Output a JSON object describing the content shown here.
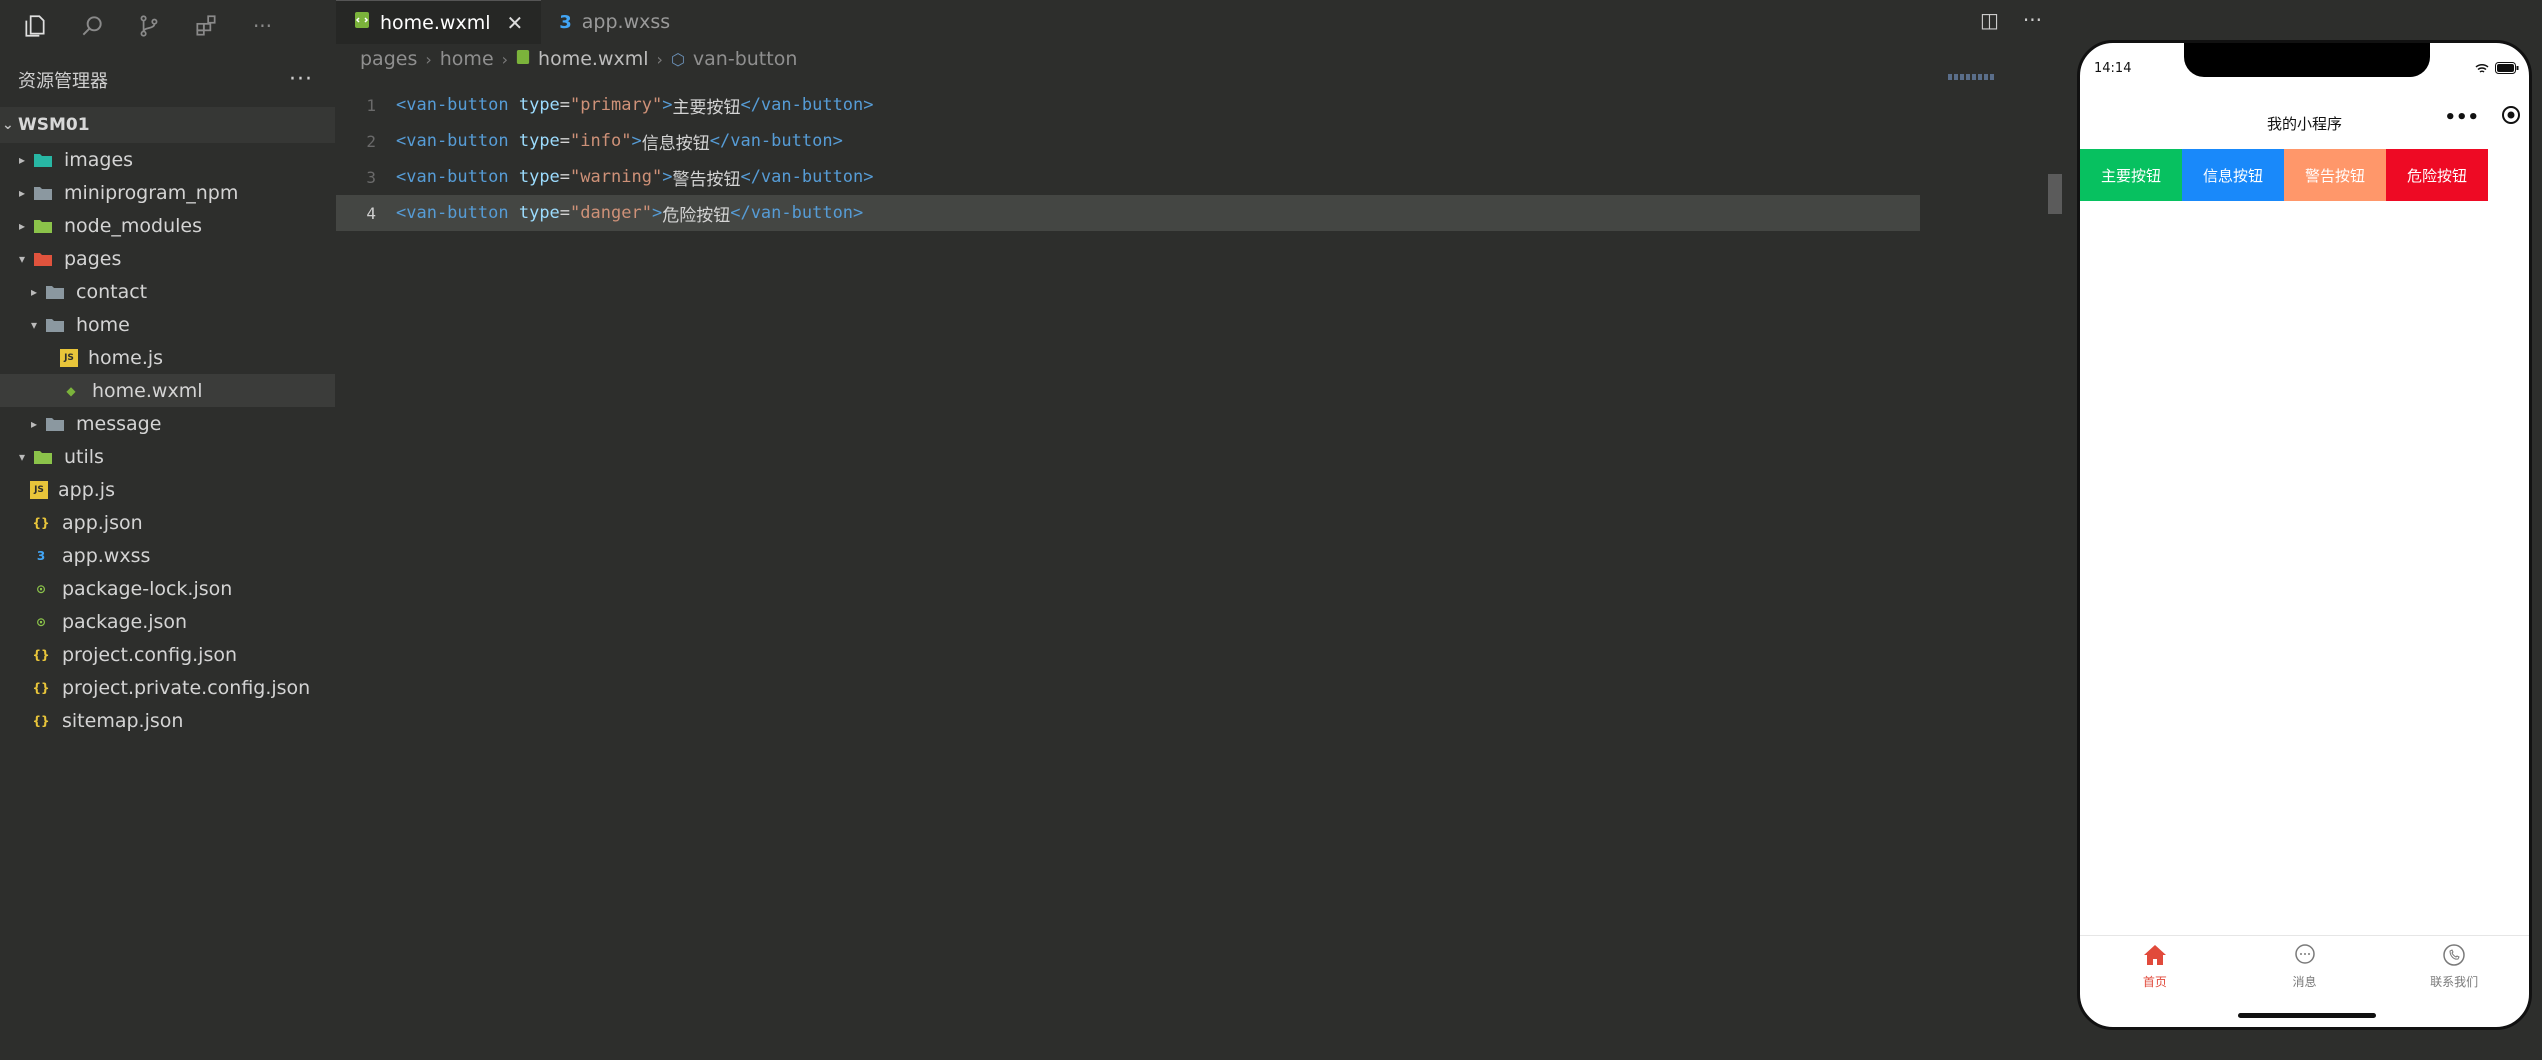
{
  "explorer": {
    "title": "资源管理器",
    "more": "···",
    "project": "WSM01",
    "items": [
      {
        "label": "images",
        "depth": 1,
        "caret": "▶",
        "icon": "images-folder-icon",
        "color": "#28b7a4",
        "active": false
      },
      {
        "label": "miniprogram_npm",
        "depth": 1,
        "caret": "▶",
        "icon": "folder-icon",
        "color": "#8b98a0",
        "active": false
      },
      {
        "label": "node_modules",
        "depth": 1,
        "caret": "▶",
        "icon": "node-folder-icon",
        "color": "#8bc34a",
        "active": false
      },
      {
        "label": "pages",
        "depth": 1,
        "caret": "▼",
        "icon": "pages-folder-icon",
        "color": "#e0533d",
        "active": false
      },
      {
        "label": "contact",
        "depth": 2,
        "caret": "▶",
        "icon": "folder-icon",
        "color": "#8b98a0",
        "active": false
      },
      {
        "label": "home",
        "depth": 2,
        "caret": "▼",
        "icon": "folder-open-icon",
        "color": "#8b98a0",
        "active": false
      },
      {
        "label": "home.js",
        "depth": 3,
        "caret": "",
        "icon": "js-file-icon",
        "color": "#e8c53a",
        "active": false
      },
      {
        "label": "home.wxml",
        "depth": 3,
        "caret": "",
        "icon": "wxml-file-icon",
        "color": "#7bb33b",
        "active": true
      },
      {
        "label": "message",
        "depth": 2,
        "caret": "▶",
        "icon": "folder-icon",
        "color": "#8b98a0",
        "active": false
      },
      {
        "label": "utils",
        "depth": 1,
        "caret": "▼",
        "icon": "utils-folder-icon",
        "color": "#8bc34a",
        "active": false
      },
      {
        "label": "app.js",
        "depth": 1,
        "caret": "",
        "icon": "js-file-icon",
        "color": "#e8c53a",
        "active": false
      },
      {
        "label": "app.json",
        "depth": 1,
        "caret": "",
        "icon": "json-file-icon",
        "color": "#e8c53a",
        "active": false
      },
      {
        "label": "app.wxss",
        "depth": 1,
        "caret": "",
        "icon": "css-file-icon",
        "color": "#42a5f5",
        "active": false
      },
      {
        "label": "package-lock.json",
        "depth": 1,
        "caret": "",
        "icon": "npm-file-icon",
        "color": "#8bc34a",
        "active": false
      },
      {
        "label": "package.json",
        "depth": 1,
        "caret": "",
        "icon": "npm-file-icon",
        "color": "#8bc34a",
        "active": false
      },
      {
        "label": "project.config.json",
        "depth": 1,
        "caret": "",
        "icon": "json-file-icon",
        "color": "#e8c53a",
        "active": false
      },
      {
        "label": "project.private.config.json",
        "depth": 1,
        "caret": "",
        "icon": "json-file-icon",
        "color": "#e8c53a",
        "active": false
      },
      {
        "label": "sitemap.json",
        "depth": 1,
        "caret": "",
        "icon": "json-file-icon",
        "color": "#e8c53a",
        "active": false
      }
    ]
  },
  "tabs": [
    {
      "label": "home.wxml",
      "active": true,
      "icon": "wxml-file-icon"
    },
    {
      "label": "app.wxss",
      "active": false,
      "icon": "css-file-icon"
    }
  ],
  "editor_actions": {
    "split": "◫",
    "more": "···"
  },
  "breadcrumb": [
    "pages",
    "home",
    "home.wxml",
    "van-button"
  ],
  "code": [
    {
      "n": "1",
      "type": "primary",
      "text": "主要按钮"
    },
    {
      "n": "2",
      "type": "info",
      "text": "信息按钮"
    },
    {
      "n": "3",
      "type": "warning",
      "text": "警告按钮"
    },
    {
      "n": "4",
      "type": "danger",
      "text": "危险按钮"
    }
  ],
  "code_tokens": {
    "open_tag": "<van-button",
    "attr": "type",
    "eq": "=",
    "close_open": ">",
    "close_tag": "</van-button>"
  },
  "phone": {
    "time": "14:14",
    "nav_title": "我的小程序",
    "capsule_more": "•••",
    "buttons": [
      {
        "label": "主要按钮",
        "color": "#07c160"
      },
      {
        "label": "信息按钮",
        "color": "#1989fa"
      },
      {
        "label": "警告按钮",
        "color": "#ff976a"
      },
      {
        "label": "危险按钮",
        "color": "#ee0a24"
      }
    ],
    "tabbar": [
      {
        "label": "首页",
        "icon": "home-icon",
        "active": true
      },
      {
        "label": "消息",
        "icon": "message-icon",
        "active": false
      },
      {
        "label": "联系我们",
        "icon": "phone-icon",
        "active": false
      }
    ]
  }
}
